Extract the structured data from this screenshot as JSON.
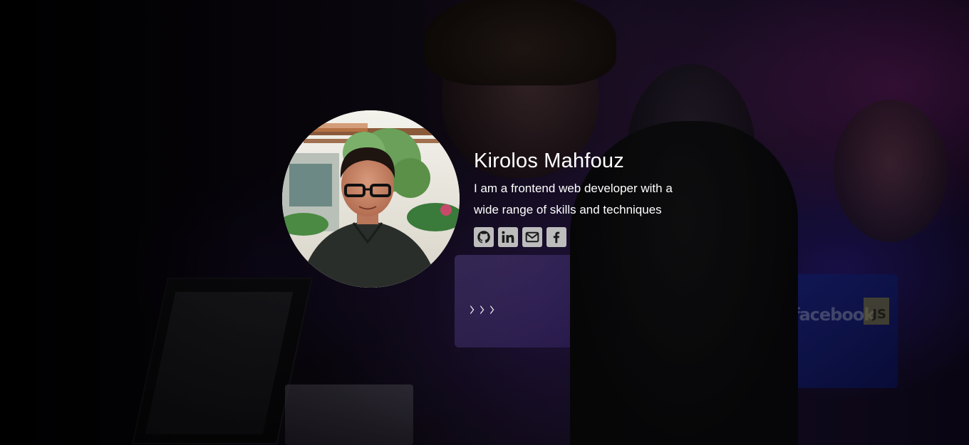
{
  "profile": {
    "name": "Kirolos Mahfouz",
    "bio": "I am a frontend web developer with a wide range of skills and techniques"
  },
  "social_links": [
    {
      "icon": "github-icon",
      "label": "GitHub"
    },
    {
      "icon": "linkedin-icon",
      "label": "LinkedIn"
    },
    {
      "icon": "email-icon",
      "label": "Email"
    },
    {
      "icon": "facebook-icon",
      "label": "Facebook"
    }
  ],
  "scroll_indicator": {
    "glyphs": [
      "›",
      "›",
      "›"
    ]
  },
  "background": {
    "laptop_brand_text": "facebook",
    "laptop_badge_text": "JS"
  },
  "colors": {
    "text": "#ffffff",
    "icon_bg": "#bdbdbd",
    "icon_fg": "#1a1a1a",
    "accent_purple": "#6a3ad8"
  }
}
